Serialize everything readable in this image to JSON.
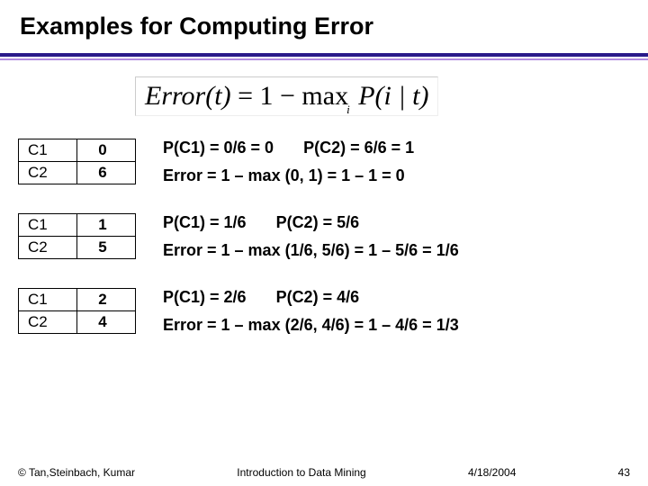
{
  "title": "Examples for Computing Error",
  "formula": {
    "lhs": "Error",
    "arg": "t",
    "rhs_prefix": "= 1 − max",
    "sub": "i",
    "prob": "P(i | t)"
  },
  "examples": [
    {
      "table": {
        "r1": {
          "label": "C1",
          "val": "0"
        },
        "r2": {
          "label": "C2",
          "val": "6"
        }
      },
      "p1": "P(C1) = 0/6 = 0",
      "p2": "P(C2) = 6/6 = 1",
      "err": "Error = 1 – max (0, 1) = 1 – 1 = 0"
    },
    {
      "table": {
        "r1": {
          "label": "C1",
          "val": "1"
        },
        "r2": {
          "label": "C2",
          "val": "5"
        }
      },
      "p1": "P(C1) = 1/6",
      "p2": "P(C2) = 5/6",
      "err": "Error = 1 – max (1/6, 5/6) = 1 – 5/6 = 1/6"
    },
    {
      "table": {
        "r1": {
          "label": "C1",
          "val": "2"
        },
        "r2": {
          "label": "C2",
          "val": "4"
        }
      },
      "p1": "P(C1) = 2/6",
      "p2": "P(C2) = 4/6",
      "err": "Error = 1 – max (2/6, 4/6) = 1 – 4/6 = 1/3"
    }
  ],
  "footer": {
    "left": "© Tan,Steinbach, Kumar",
    "center": "Introduction to Data Mining",
    "date": "4/18/2004",
    "page": "43"
  }
}
